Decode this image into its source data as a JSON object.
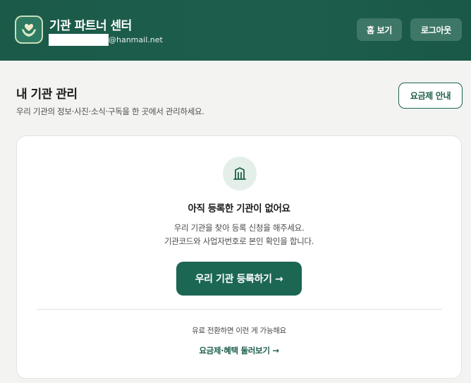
{
  "header": {
    "title": "기관 파트너 센터",
    "email_domain": "@hanmail.net",
    "home_label": "홈 보기",
    "logout_label": "로그아웃",
    "logo_icon": "heart-hands-icon"
  },
  "main": {
    "title": "내 기관 관리",
    "description": "우리 기관의 정보·사진·소식·구독을 한 곳에서 관리하세요.",
    "plan_button_label": "요금제 안내"
  },
  "empty_state": {
    "icon": "building-icon",
    "title": "아직 등록한 기관이 없어요",
    "line1": "우리 기관을 찾아 등록 신청을 해주세요.",
    "line2": "기관코드와 사업자번호로 본인 확인을 합니다.",
    "register_label": "우리 기관 등록하기 →",
    "upsell_text": "유료 전환하면 이런 게 가능해요",
    "upsell_link": "요금제·혜택 둘러보기 →"
  },
  "colors": {
    "brand": "#1c5e4c",
    "header_bg": "#1b5a49",
    "page_bg": "#f3f3f1"
  }
}
